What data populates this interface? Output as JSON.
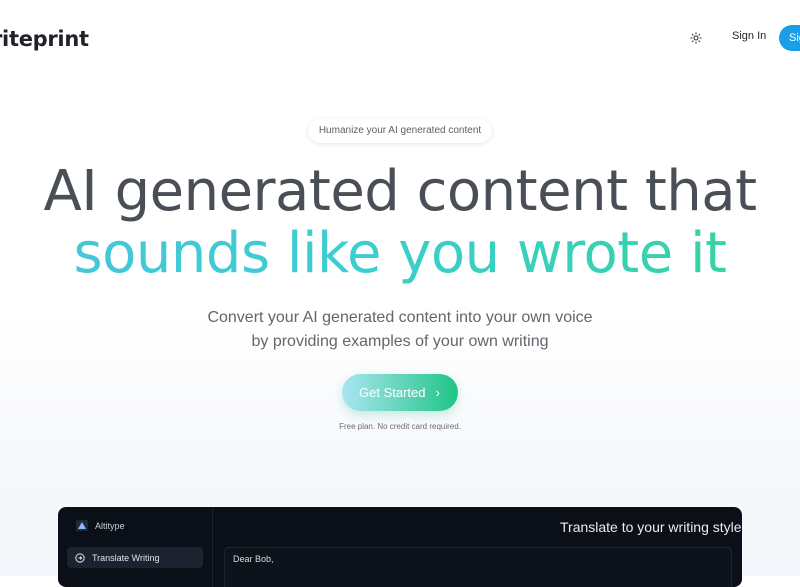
{
  "header": {
    "logo": "riteprint",
    "theme_toggle_icon": "sun-icon",
    "sign_in": "Sign In",
    "sign_up": "Sig"
  },
  "hero": {
    "pill": "Humanize your AI generated content",
    "title_line1": "AI generated content that",
    "title_line2": "sounds like you wrote it",
    "subtitle_line1": "Convert your AI generated content into your own voice",
    "subtitle_line2": "by providing examples of your own writing",
    "cta_label": "Get Started",
    "cta_icon": "chevron-right-icon",
    "note": "Free plan. No credit card required."
  },
  "app_preview": {
    "brand": "Altitype",
    "nav_item": "Translate Writing",
    "title": "Translate to your writing style",
    "editor_text": "Dear Bob,"
  },
  "colors": {
    "accent_blue": "#1a9ee8",
    "gradient_start": "#46c6dc",
    "gradient_end": "#34d49c",
    "dark_panel": "#0b0f17"
  }
}
